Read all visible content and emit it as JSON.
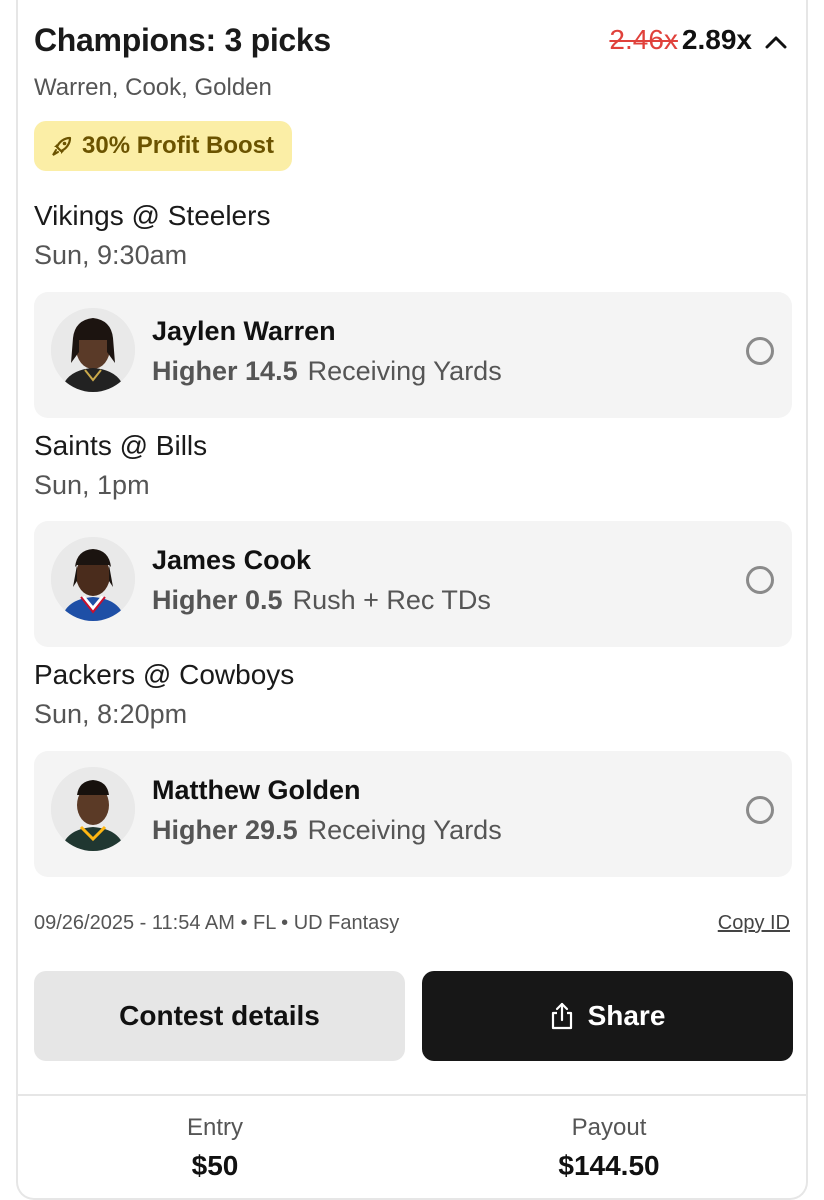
{
  "entry_card": {
    "title": "Champions: 3 picks",
    "multiplier_old": "2.46x",
    "multiplier_new": "2.89x",
    "subtitle": "Warren, Cook, Golden",
    "boost_label": "30% Profit Boost"
  },
  "games": [
    {
      "name": "Vikings @ Steelers",
      "time": "Sun, 9:30am",
      "pick": {
        "player": "Jaylen Warren",
        "direction": "Higher",
        "line": "14.5",
        "stat": "Receiving Yards"
      }
    },
    {
      "name": "Saints @ Bills",
      "time": "Sun, 1pm",
      "pick": {
        "player": "James Cook",
        "direction": "Higher",
        "line": "0.5",
        "stat": "Rush + Rec TDs"
      }
    },
    {
      "name": "Packers @ Cowboys",
      "time": "Sun, 8:20pm",
      "pick": {
        "player": "Matthew Golden",
        "direction": "Higher",
        "line": "29.5",
        "stat": "Receiving Yards"
      }
    }
  ],
  "meta": {
    "info": "09/26/2025 - 11:54 AM • FL • UD Fantasy",
    "copy_id_label": "Copy ID"
  },
  "actions": {
    "details_label": "Contest details",
    "share_label": "Share"
  },
  "footer": {
    "entry_label": "Entry",
    "entry_value": "$50",
    "payout_label": "Payout",
    "payout_value": "$144.50"
  },
  "colors": {
    "boost_bg": "#fbeea6",
    "boost_text": "#6b5300",
    "strike_red": "#e0413b",
    "share_bg": "#171717"
  }
}
